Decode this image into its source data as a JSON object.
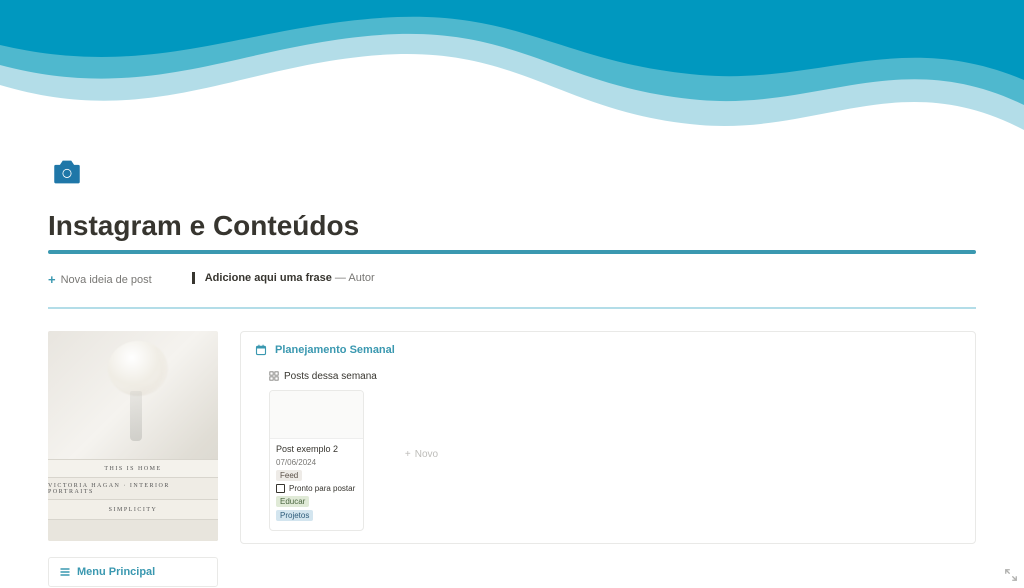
{
  "page": {
    "title": "Instagram e Conteúdos"
  },
  "actions": {
    "new_idea_label": "Nova ideia de post"
  },
  "quote": {
    "text": "Adicione aqui uma frase",
    "author_prefix": " — ",
    "author": "Autor"
  },
  "sidebar_image": {
    "book_labels": [
      "THIS IS HOME",
      "VICTORIA HAGAN · INTERIOR PORTRAITS",
      "SIMPLICITY",
      ""
    ]
  },
  "menu": {
    "label": "Menu Principal"
  },
  "planning": {
    "title": "Planejamento Semanal",
    "view_label": "Posts dessa semana",
    "new_label": "Novo",
    "cards": [
      {
        "title": "Post exemplo 2",
        "date": "07/06/2024",
        "tag_type": "Feed",
        "checkbox_label": "Pronto para postar",
        "tag_pillar": "Educar",
        "tag_project": "Projetos"
      }
    ]
  }
}
